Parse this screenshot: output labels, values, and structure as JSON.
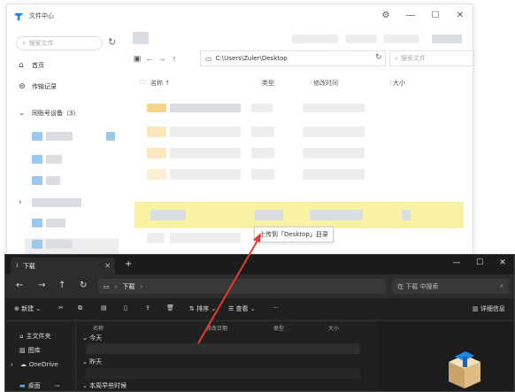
{
  "app": {
    "title": "文件中心",
    "search_placeholder": "搜索文件",
    "sidebar": {
      "home": "首页",
      "transfer": "传输记录",
      "devices_label": "同账号设备（3）"
    },
    "path": "C:\\Users\\Zuler\\Desktop",
    "file_search_placeholder": "搜索文件",
    "columns": {
      "name": "名称",
      "type": "类型",
      "modified": "修改时间",
      "size": "大小"
    },
    "tooltip": "上传到「Desktop」目录",
    "colors": {
      "accent": "#1e88e5",
      "highlight": "#f8f3a3"
    }
  },
  "explorer": {
    "tab_label": "下载",
    "breadcrumb": "下载",
    "search_placeholder": "在 下载 中搜索",
    "toolbar": {
      "new": "新建",
      "sort": "排序",
      "view": "查看",
      "more": "···",
      "details": "详细信息"
    },
    "sidebar": {
      "home": "主文件夹",
      "gallery": "图库",
      "onedrive": "OneDrive",
      "desktop": "桌面"
    },
    "columns": {
      "name": "名称",
      "modified": "修改日期",
      "type": "类型",
      "size": "大小"
    },
    "groups": {
      "today": "今天",
      "yesterday": "昨天",
      "earlier_this_week": "本周早些时候"
    }
  }
}
